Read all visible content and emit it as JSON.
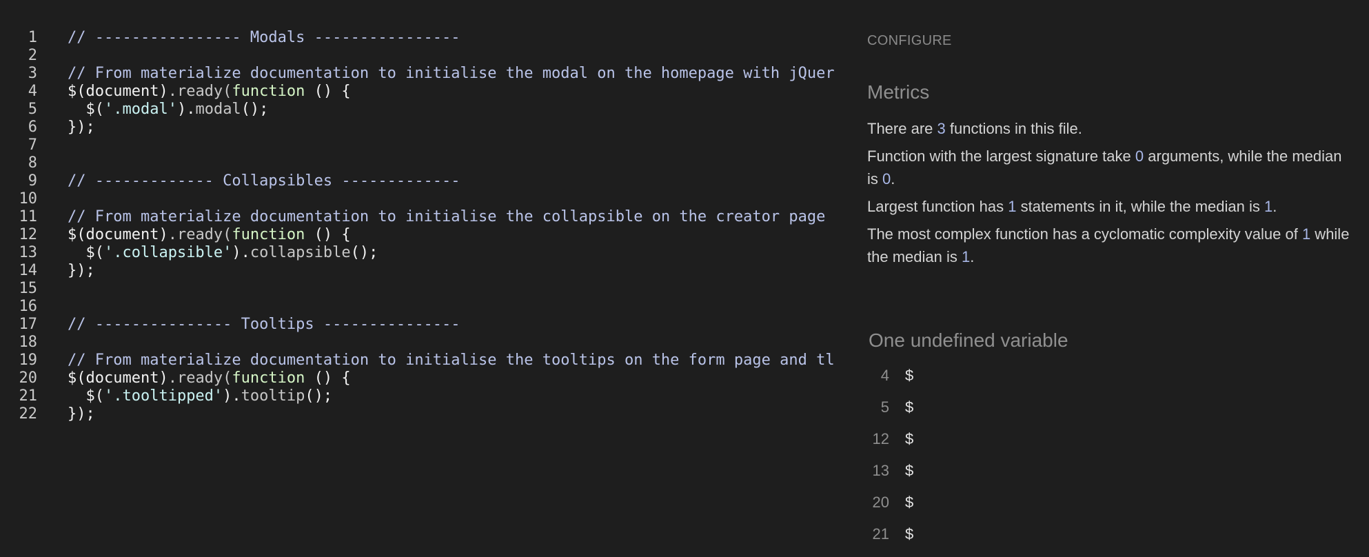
{
  "editor": {
    "lines": [
      {
        "n": "1",
        "tokens": [
          {
            "t": "// ---------------- Modals ----------------",
            "c": "comment"
          }
        ]
      },
      {
        "n": "2",
        "tokens": []
      },
      {
        "n": "3",
        "tokens": [
          {
            "t": "// From materialize documentation to initialise the modal on the homepage with jQuer",
            "c": "comment"
          }
        ]
      },
      {
        "n": "4",
        "tokens": [
          {
            "t": "$(document)",
            "c": "plain"
          },
          {
            "t": ".ready(",
            "c": "prop"
          },
          {
            "t": "function",
            "c": "keyword"
          },
          {
            "t": " () {",
            "c": "plain"
          }
        ]
      },
      {
        "n": "5",
        "tokens": [
          {
            "t": "  $(",
            "c": "plain"
          },
          {
            "t": "'.modal'",
            "c": "string"
          },
          {
            "t": ").",
            "c": "plain"
          },
          {
            "t": "modal",
            "c": "prop"
          },
          {
            "t": "();",
            "c": "plain"
          }
        ]
      },
      {
        "n": "6",
        "tokens": [
          {
            "t": "});",
            "c": "plain"
          }
        ]
      },
      {
        "n": "7",
        "tokens": []
      },
      {
        "n": "8",
        "tokens": []
      },
      {
        "n": "9",
        "tokens": [
          {
            "t": "// ------------- Collapsibles -------------",
            "c": "comment"
          }
        ]
      },
      {
        "n": "10",
        "tokens": []
      },
      {
        "n": "11",
        "tokens": [
          {
            "t": "// From materialize documentation to initialise the collapsible on the creator page",
            "c": "comment"
          }
        ]
      },
      {
        "n": "12",
        "tokens": [
          {
            "t": "$(document)",
            "c": "plain"
          },
          {
            "t": ".ready(",
            "c": "prop"
          },
          {
            "t": "function",
            "c": "keyword"
          },
          {
            "t": " () {",
            "c": "plain"
          }
        ]
      },
      {
        "n": "13",
        "tokens": [
          {
            "t": "  $(",
            "c": "plain"
          },
          {
            "t": "'.collapsible'",
            "c": "string"
          },
          {
            "t": ").",
            "c": "plain"
          },
          {
            "t": "collapsible",
            "c": "prop"
          },
          {
            "t": "();",
            "c": "plain"
          }
        ]
      },
      {
        "n": "14",
        "tokens": [
          {
            "t": "});",
            "c": "plain"
          }
        ]
      },
      {
        "n": "15",
        "tokens": []
      },
      {
        "n": "16",
        "tokens": []
      },
      {
        "n": "17",
        "tokens": [
          {
            "t": "// --------------- Tooltips ---------------",
            "c": "comment"
          }
        ]
      },
      {
        "n": "18",
        "tokens": []
      },
      {
        "n": "19",
        "tokens": [
          {
            "t": "// From materialize documentation to initialise the tooltips on the form page and tl",
            "c": "comment"
          }
        ]
      },
      {
        "n": "20",
        "tokens": [
          {
            "t": "$(document)",
            "c": "plain"
          },
          {
            "t": ".ready(",
            "c": "prop"
          },
          {
            "t": "function",
            "c": "keyword"
          },
          {
            "t": " () {",
            "c": "plain"
          }
        ]
      },
      {
        "n": "21",
        "tokens": [
          {
            "t": "  $(",
            "c": "plain"
          },
          {
            "t": "'.tooltipped'",
            "c": "string"
          },
          {
            "t": ").",
            "c": "plain"
          },
          {
            "t": "tooltip",
            "c": "prop"
          },
          {
            "t": "();",
            "c": "plain"
          }
        ]
      },
      {
        "n": "22",
        "tokens": [
          {
            "t": "});",
            "c": "plain"
          }
        ]
      }
    ]
  },
  "sidebar": {
    "configure_label": "CONFIGURE",
    "metrics_title": "Metrics",
    "metrics": [
      [
        {
          "t": "There are "
        },
        {
          "t": "3",
          "num": true
        },
        {
          "t": " functions in this file."
        }
      ],
      [
        {
          "t": "Function with the largest signature take "
        },
        {
          "t": "0",
          "num": true
        },
        {
          "t": " arguments, while the median is "
        },
        {
          "t": "0",
          "num": true
        },
        {
          "t": "."
        }
      ],
      [
        {
          "t": "Largest function has "
        },
        {
          "t": "1",
          "num": true
        },
        {
          "t": " statements in it, while the median is "
        },
        {
          "t": "1",
          "num": true
        },
        {
          "t": "."
        }
      ],
      [
        {
          "t": "The most complex function has a cyclomatic complexity value of "
        },
        {
          "t": "1",
          "num": true
        },
        {
          "t": " while the median is "
        },
        {
          "t": "1",
          "num": true
        },
        {
          "t": "."
        }
      ]
    ],
    "undefined_title": "One undefined variable",
    "undefined_vars": [
      {
        "line": "4",
        "name": "$"
      },
      {
        "line": "5",
        "name": "$"
      },
      {
        "line": "12",
        "name": "$"
      },
      {
        "line": "13",
        "name": "$"
      },
      {
        "line": "20",
        "name": "$"
      },
      {
        "line": "21",
        "name": "$"
      }
    ]
  }
}
